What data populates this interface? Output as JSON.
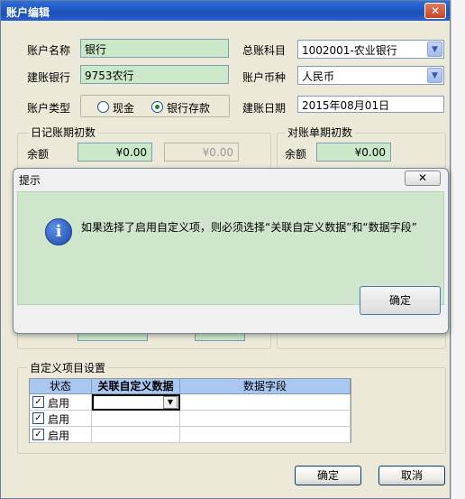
{
  "window": {
    "title": "账户编辑",
    "close_glyph": "✕"
  },
  "form": {
    "account_name_label": "账户名称",
    "account_name_value": "银行",
    "ledger_subject_label": "总账科目",
    "ledger_subject_value": "1002001-农业银行",
    "account_bank_label": "建账银行",
    "account_bank_value": "9753农行",
    "currency_label": "账户币种",
    "currency_value": "人民币",
    "account_type_label": "账户类型",
    "account_type_options": [
      "现金",
      "银行存款"
    ],
    "account_type_selected": "银行存款",
    "open_date_label": "建账日期",
    "open_date_value": "2015年08月01日"
  },
  "journal_group": {
    "title": "日记账期初数",
    "balance_label": "余额",
    "balance_value": "¥0.00",
    "balance_value_2": "¥0.00"
  },
  "statement_group": {
    "title": "对账单期初数",
    "balance_label": "余额",
    "balance_value": "¥0.00"
  },
  "custom_group": {
    "title": "自定义项目设置",
    "columns": [
      "状态",
      "关联自定义数据",
      "数据字段"
    ],
    "rows": [
      {
        "checked": true,
        "status": "启用"
      },
      {
        "checked": true,
        "status": "启用"
      },
      {
        "checked": true,
        "status": "启用"
      }
    ]
  },
  "buttons": {
    "ok": "确定",
    "cancel": "取消"
  },
  "dialog": {
    "title": "提示",
    "close_glyph": "✕",
    "icon": "info-icon",
    "message": "如果选择了启用自定义项，则必须选择“关联自定义数据”和“数据字段”",
    "ok": "确定"
  },
  "colors": {
    "title_blue": "#2a62d0",
    "field_green": "#cbe8c8",
    "dialog_body_green": "#cfe5cc",
    "grid_header_blue": "#a9c7f0"
  }
}
